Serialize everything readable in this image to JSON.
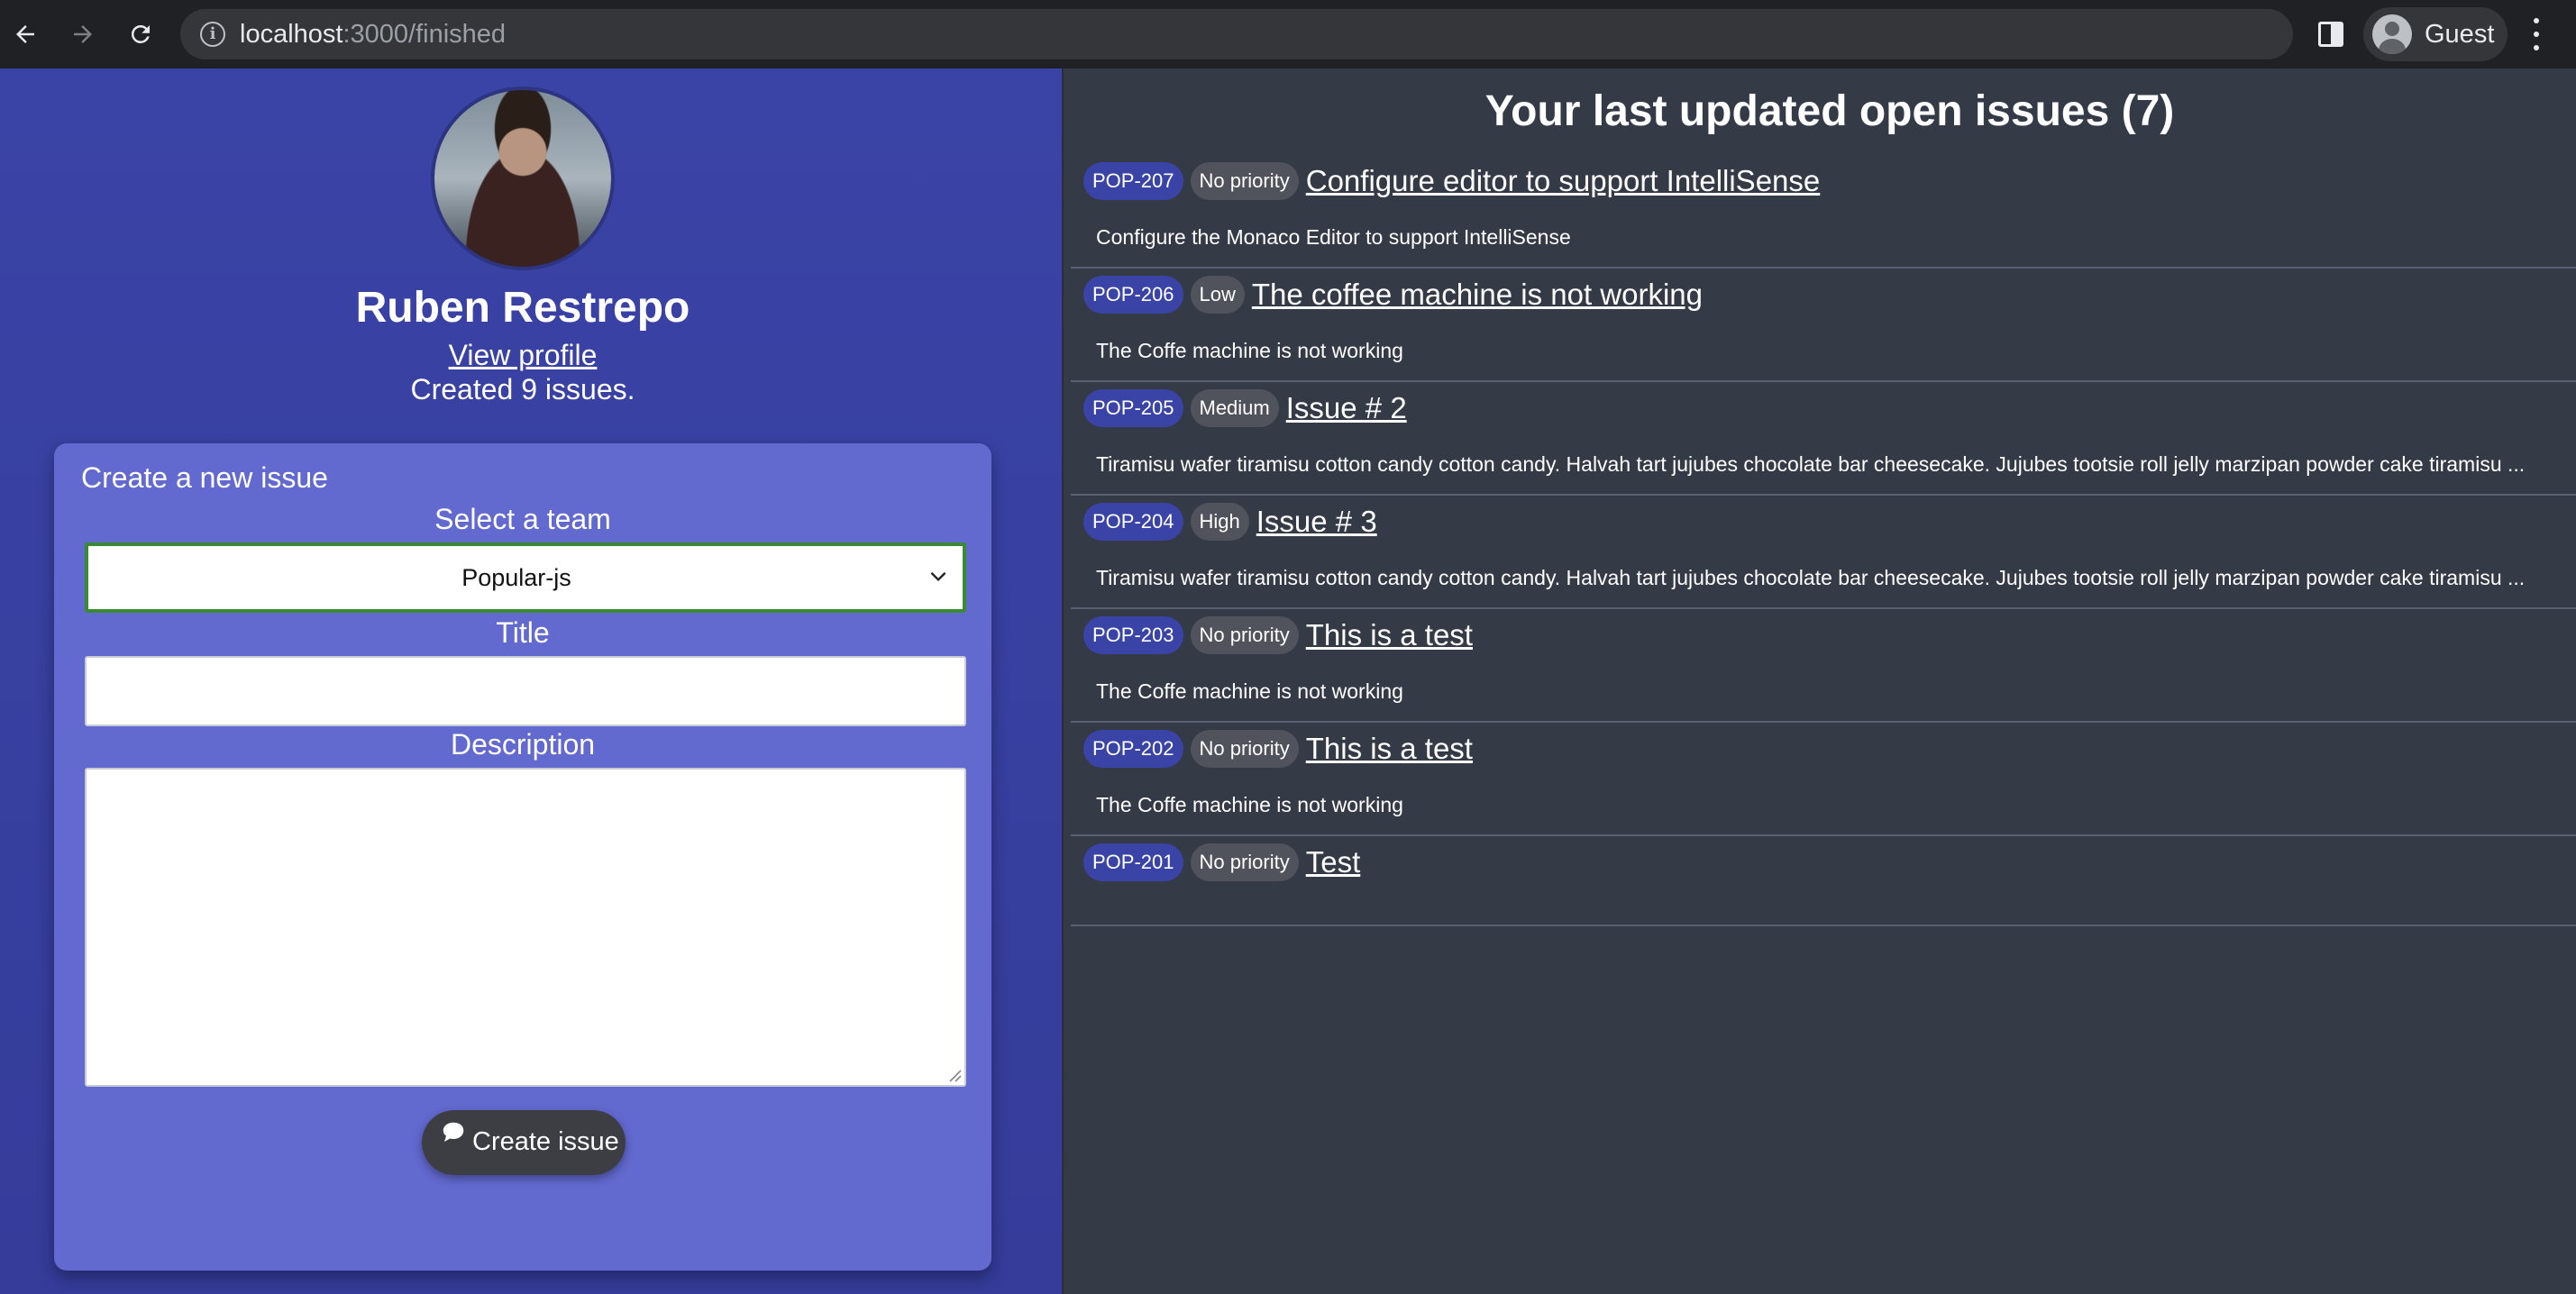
{
  "browser": {
    "url_host": "localhost",
    "url_path": ":3000/finished",
    "profile_label": "Guest"
  },
  "user": {
    "name": "Ruben Restrepo",
    "view_profile": "View profile",
    "created_text": "Created 9 issues."
  },
  "form": {
    "title": "Create a new issue",
    "team_label": "Select a team",
    "team_value": "Popular-js",
    "title_label": "Title",
    "title_value": "",
    "description_label": "Description",
    "description_value": "",
    "submit_label": "Create issue"
  },
  "issues": {
    "heading": "Your last updated open issues (7)",
    "items": [
      {
        "id": "POP-207",
        "priority": "No priority",
        "title": "Configure editor to support IntelliSense",
        "description": "Configure the Monaco Editor to support IntelliSense"
      },
      {
        "id": "POP-206",
        "priority": "Low",
        "title": "The coffee machine is not working",
        "description": "The Coffe machine is not working"
      },
      {
        "id": "POP-205",
        "priority": "Medium",
        "title": "Issue # 2",
        "description": "Tiramisu wafer tiramisu cotton candy cotton candy. Halvah tart jujubes chocolate bar cheesecake. Jujubes tootsie roll jelly marzipan powder cake tiramisu ..."
      },
      {
        "id": "POP-204",
        "priority": "High",
        "title": "Issue # 3",
        "description": "Tiramisu wafer tiramisu cotton candy cotton candy. Halvah tart jujubes chocolate bar cheesecake. Jujubes tootsie roll jelly marzipan powder cake tiramisu ..."
      },
      {
        "id": "POP-203",
        "priority": "No priority",
        "title": "This is a test",
        "description": "The Coffe machine is not working"
      },
      {
        "id": "POP-202",
        "priority": "No priority",
        "title": "This is a test",
        "description": "The Coffe machine is not working"
      },
      {
        "id": "POP-201",
        "priority": "No priority",
        "title": "Test",
        "description": ""
      }
    ]
  }
}
